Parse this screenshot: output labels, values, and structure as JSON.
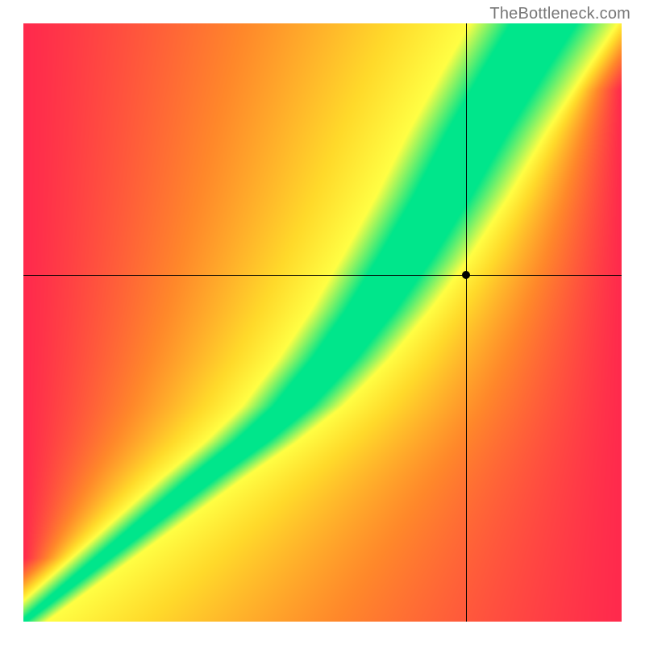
{
  "watermark": "TheBottleneck.com",
  "chart_data": {
    "type": "heatmap",
    "title": "",
    "xlabel": "",
    "ylabel": "",
    "xlim": [
      0,
      100
    ],
    "ylim": [
      0,
      100
    ],
    "note": "Value 100 corresponds to green (optimal), decreasing values transition through yellow to red. The green ridge traces the optimal hardware pairing curve. Axes represent normalized CPU (x, 0–100) and GPU (y, 0–100) scores.",
    "crosshair": {
      "x": 74,
      "y": 58
    },
    "marker": {
      "x": 74,
      "y": 58,
      "color": "#000000"
    },
    "color_scale": [
      {
        "value": 0,
        "color": "#ff2a4d"
      },
      {
        "value": 40,
        "color": "#ff8a2a"
      },
      {
        "value": 70,
        "color": "#ffd92a"
      },
      {
        "value": 88,
        "color": "#ffff44"
      },
      {
        "value": 100,
        "color": "#00e68b"
      }
    ],
    "ridge_curve": {
      "description": "Approximate locus of the green optimal band (x,y in 0–100, x=CPU, y=GPU).",
      "points": [
        [
          0,
          0
        ],
        [
          10,
          8
        ],
        [
          20,
          16
        ],
        [
          30,
          24
        ],
        [
          38,
          30
        ],
        [
          45,
          36
        ],
        [
          52,
          44
        ],
        [
          58,
          52
        ],
        [
          64,
          61
        ],
        [
          70,
          71
        ],
        [
          76,
          82
        ],
        [
          82,
          92
        ],
        [
          87,
          100
        ]
      ],
      "band_halfwidth_at_y": [
        [
          0,
          0.5
        ],
        [
          20,
          2
        ],
        [
          40,
          3.5
        ],
        [
          60,
          4.5
        ],
        [
          80,
          5
        ],
        [
          100,
          5.5
        ]
      ]
    },
    "legend": []
  }
}
